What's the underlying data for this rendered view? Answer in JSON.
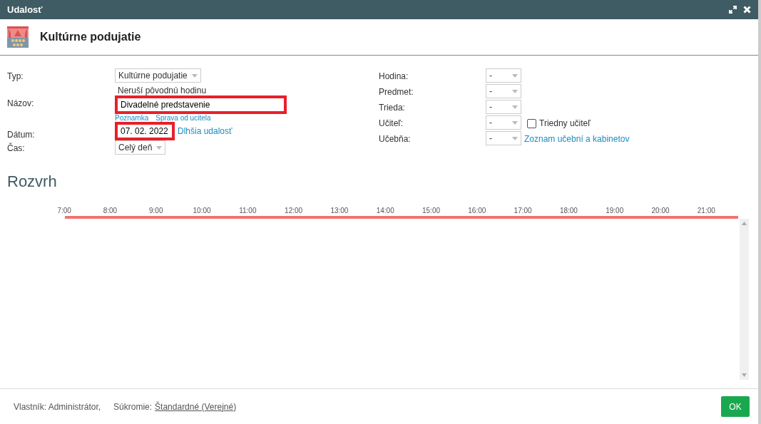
{
  "window": {
    "title": "Udalosť"
  },
  "header": {
    "title": "Kultúrne podujatie"
  },
  "form_left": [
    {
      "kind": "select",
      "label": "Typ:",
      "value": "Kultúrne podujatie",
      "note": "Neruší pôvodnú hodinu"
    },
    {
      "kind": "input",
      "label": "Názov:",
      "value": "Divadelné predstavenie",
      "links": [
        "Poznamka",
        "Sprava od ucitela"
      ],
      "highlighted": true
    },
    {
      "kind": "input",
      "label": "Dátum:",
      "value": "07. 02. 2022",
      "link": "Dlhšia udalosť",
      "highlighted": true
    },
    {
      "kind": "select",
      "label": "Čas:",
      "value": "Celý deň"
    }
  ],
  "form_right": [
    {
      "label": "Hodina:",
      "value": "-"
    },
    {
      "label": "Predmet:",
      "value": "-"
    },
    {
      "label": "Trieda:",
      "value": "-"
    },
    {
      "label": "Učiteľ:",
      "value": "-",
      "checkbox": {
        "label": "Triedny učiteľ",
        "checked": false
      }
    },
    {
      "label": "Učebňa:",
      "value": "-",
      "link": "Zoznam učební a kabinetov"
    }
  ],
  "schedule": {
    "title": "Rozvrh",
    "hours": [
      "7:00",
      "8:00",
      "9:00",
      "10:00",
      "11:00",
      "12:00",
      "13:00",
      "14:00",
      "15:00",
      "16:00",
      "17:00",
      "18:00",
      "19:00",
      "20:00",
      "21:00"
    ]
  },
  "footer": {
    "owner": "Vlastník: Administrátor,",
    "privacy_label": "Súkromie:",
    "privacy_value": "Štandardné (Verejné)",
    "ok": "OK"
  }
}
